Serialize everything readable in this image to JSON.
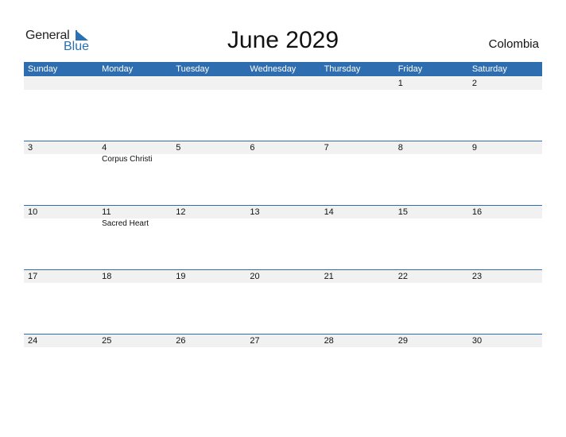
{
  "logo": {
    "general": "General",
    "blue": "Blue"
  },
  "title": "June 2029",
  "country": "Colombia",
  "colors": {
    "accent": "#2e6eb0",
    "daybar": "#f1f1f1"
  },
  "weekdays": [
    "Sunday",
    "Monday",
    "Tuesday",
    "Wednesday",
    "Thursday",
    "Friday",
    "Saturday"
  ],
  "weeks": [
    {
      "days": [
        "",
        "",
        "",
        "",
        "",
        "1",
        "2"
      ],
      "events": [
        "",
        "",
        "",
        "",
        "",
        "",
        ""
      ]
    },
    {
      "days": [
        "3",
        "4",
        "5",
        "6",
        "7",
        "8",
        "9"
      ],
      "events": [
        "",
        "Corpus Christi",
        "",
        "",
        "",
        "",
        ""
      ]
    },
    {
      "days": [
        "10",
        "11",
        "12",
        "13",
        "14",
        "15",
        "16"
      ],
      "events": [
        "",
        "Sacred Heart",
        "",
        "",
        "",
        "",
        ""
      ]
    },
    {
      "days": [
        "17",
        "18",
        "19",
        "20",
        "21",
        "22",
        "23"
      ],
      "events": [
        "",
        "",
        "",
        "",
        "",
        "",
        ""
      ]
    },
    {
      "days": [
        "24",
        "25",
        "26",
        "27",
        "28",
        "29",
        "30"
      ],
      "events": [
        "",
        "",
        "",
        "",
        "",
        "",
        ""
      ]
    }
  ]
}
